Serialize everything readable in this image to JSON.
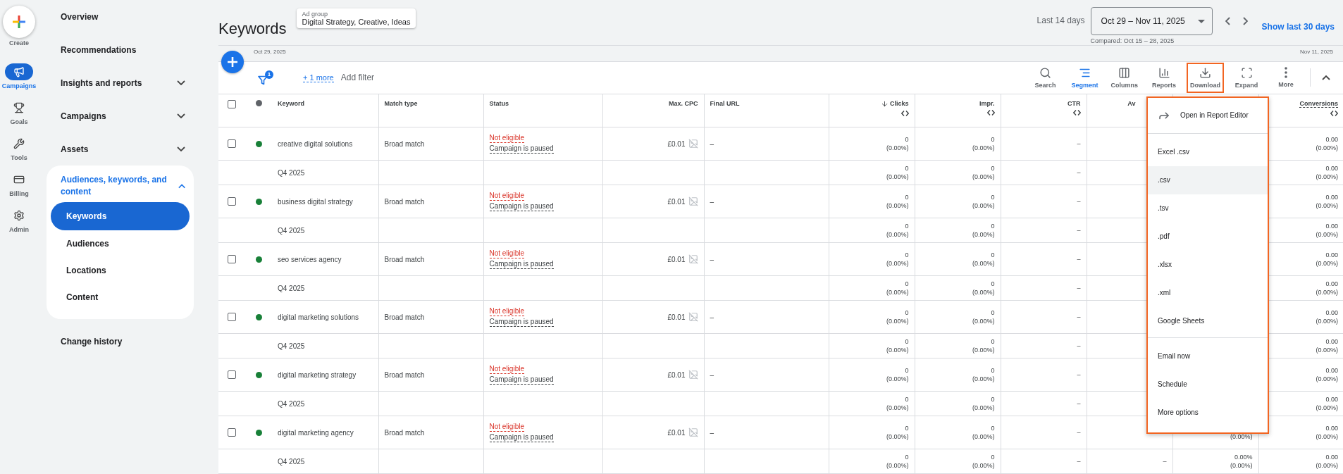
{
  "create": {
    "label": "Create"
  },
  "rail": [
    {
      "label": "Campaigns",
      "selected": true
    },
    {
      "label": "Goals",
      "selected": false
    },
    {
      "label": "Tools",
      "selected": false
    },
    {
      "label": "Billing",
      "selected": false
    },
    {
      "label": "Admin",
      "selected": false
    }
  ],
  "nav": [
    {
      "kind": "link",
      "label": "Overview"
    },
    {
      "kind": "link",
      "label": "Recommendations"
    },
    {
      "kind": "group",
      "label": "Insights and reports",
      "expanded": false
    },
    {
      "kind": "group",
      "label": "Campaigns",
      "expanded": false
    },
    {
      "kind": "group",
      "label": "Assets",
      "expanded": false
    },
    {
      "kind": "group",
      "label": "Audiences, keywords, and content",
      "expanded": true,
      "children": [
        {
          "label": "Keywords",
          "selected": true
        },
        {
          "label": "Audiences",
          "selected": false
        },
        {
          "label": "Locations",
          "selected": false
        },
        {
          "label": "Content",
          "selected": false
        }
      ]
    },
    {
      "kind": "link",
      "label": "Change history"
    }
  ],
  "header": {
    "title": "Keywords",
    "ad_group_label": "Ad group",
    "ad_group": "Digital Strategy, Creative, Ideas",
    "range_label": "Last 14 days",
    "date_range": "Oct 29 – Nov 11, 2025",
    "compared": "Compared: Oct 15 – 28, 2025",
    "show_link": "Show last 30 days"
  },
  "timeline": {
    "start": "Oct 29, 2025",
    "end": "Nov 11, 2025"
  },
  "filter": {
    "count": "1",
    "more": "+ 1 more",
    "add": "Add filter"
  },
  "toolbar": [
    {
      "label": "Search",
      "selected": false,
      "highlighted": false
    },
    {
      "label": "Segment",
      "selected": true,
      "highlighted": false
    },
    {
      "label": "Columns",
      "selected": false,
      "highlighted": false
    },
    {
      "label": "Reports",
      "selected": false,
      "highlighted": false
    },
    {
      "label": "Download",
      "selected": false,
      "highlighted": true
    },
    {
      "label": "Expand",
      "selected": false,
      "highlighted": false
    },
    {
      "label": "More",
      "selected": false,
      "highlighted": false
    }
  ],
  "table": {
    "header_checked": false,
    "columns": {
      "keyword": {
        "label": "Keyword"
      },
      "match_type": {
        "label": "Match type"
      },
      "status": {
        "label": "Status"
      },
      "max_cpc": {
        "label": "Max. CPC"
      },
      "final_url": {
        "label": "Final URL"
      },
      "clicks": {
        "label": "Clicks",
        "sorted": true,
        "toggle": true,
        "underlined": false
      },
      "impr": {
        "label": "Impr.",
        "sorted": false,
        "toggle": true,
        "underlined": false
      },
      "ctr": {
        "label": "CTR",
        "sorted": false,
        "toggle": true,
        "underlined": false
      },
      "av": {
        "label": "Av",
        "sorted": false,
        "toggle": false,
        "underlined": false
      },
      "conversions": {
        "label": "Conversions",
        "sorted": false,
        "toggle": true,
        "underlined": true
      }
    },
    "rows": [
      {
        "kind": "keyword",
        "checked": false,
        "active": true,
        "keyword": "creative digital solutions",
        "match_type": "Broad match",
        "status": "Not eligible",
        "status_reason": "Campaign is paused",
        "max_cpc": "£0.01",
        "final_url": "–",
        "metrics": {
          "clicks": {
            "value": "0",
            "pct": "(0.00%)"
          },
          "impr": {
            "value": "0",
            "pct": "(0.00%)"
          },
          "ctr": {
            "value": "–"
          },
          "conversions": {
            "value": "0.00",
            "pct": "(0.00%)"
          }
        }
      },
      {
        "kind": "segment",
        "label": "Q4 2025",
        "metrics": {
          "clicks": {
            "value": "0",
            "pct": "(0.00%)"
          },
          "impr": {
            "value": "0",
            "pct": "(0.00%)"
          },
          "ctr": {
            "value": "–"
          },
          "conversions": {
            "value": "0.00",
            "pct": "(0.00%)"
          }
        }
      },
      {
        "kind": "keyword",
        "checked": false,
        "active": true,
        "keyword": "business digital strategy",
        "match_type": "Broad match",
        "status": "Not eligible",
        "status_reason": "Campaign is paused",
        "max_cpc": "£0.01",
        "final_url": "–",
        "metrics": {
          "clicks": {
            "value": "0",
            "pct": "(0.00%)"
          },
          "impr": {
            "value": "0",
            "pct": "(0.00%)"
          },
          "ctr": {
            "value": "–"
          },
          "conversions": {
            "value": "0.00",
            "pct": "(0.00%)"
          }
        }
      },
      {
        "kind": "segment",
        "label": "Q4 2025",
        "metrics": {
          "clicks": {
            "value": "0",
            "pct": "(0.00%)"
          },
          "impr": {
            "value": "0",
            "pct": "(0.00%)"
          },
          "ctr": {
            "value": "–"
          },
          "conversions": {
            "value": "0.00",
            "pct": "(0.00%)"
          }
        }
      },
      {
        "kind": "keyword",
        "checked": false,
        "active": true,
        "keyword": "seo services agency",
        "match_type": "Broad match",
        "status": "Not eligible",
        "status_reason": "Campaign is paused",
        "max_cpc": "£0.01",
        "final_url": "–",
        "metrics": {
          "clicks": {
            "value": "0",
            "pct": "(0.00%)"
          },
          "impr": {
            "value": "0",
            "pct": "(0.00%)"
          },
          "ctr": {
            "value": "–"
          },
          "conversions": {
            "value": "0.00",
            "pct": "(0.00%)"
          }
        }
      },
      {
        "kind": "segment",
        "label": "Q4 2025",
        "metrics": {
          "clicks": {
            "value": "0",
            "pct": "(0.00%)"
          },
          "impr": {
            "value": "0",
            "pct": "(0.00%)"
          },
          "ctr": {
            "value": "–"
          },
          "conversions": {
            "value": "0.00",
            "pct": "(0.00%)"
          }
        }
      },
      {
        "kind": "keyword",
        "checked": false,
        "active": true,
        "keyword": "digital marketing solutions",
        "match_type": "Broad match",
        "status": "Not eligible",
        "status_reason": "Campaign is paused",
        "max_cpc": "£0.01",
        "final_url": "–",
        "metrics": {
          "clicks": {
            "value": "0",
            "pct": "(0.00%)"
          },
          "impr": {
            "value": "0",
            "pct": "(0.00%)"
          },
          "ctr": {
            "value": "–"
          },
          "conversions": {
            "value": "0.00",
            "pct": "(0.00%)"
          }
        }
      },
      {
        "kind": "segment",
        "label": "Q4 2025",
        "metrics": {
          "clicks": {
            "value": "0",
            "pct": "(0.00%)"
          },
          "impr": {
            "value": "0",
            "pct": "(0.00%)"
          },
          "ctr": {
            "value": "–"
          },
          "conversions": {
            "value": "0.00",
            "pct": "(0.00%)"
          }
        }
      },
      {
        "kind": "keyword",
        "checked": false,
        "active": true,
        "keyword": "digital marketing strategy",
        "match_type": "Broad match",
        "status": "Not eligible",
        "status_reason": "Campaign is paused",
        "max_cpc": "£0.01",
        "final_url": "–",
        "metrics": {
          "clicks": {
            "value": "0",
            "pct": "(0.00%)"
          },
          "impr": {
            "value": "0",
            "pct": "(0.00%)"
          },
          "ctr": {
            "value": "–"
          },
          "conversions": {
            "value": "0.00",
            "pct": "(0.00%)"
          }
        }
      },
      {
        "kind": "segment",
        "label": "Q4 2025",
        "metrics": {
          "clicks": {
            "value": "0",
            "pct": "(0.00%)"
          },
          "impr": {
            "value": "0",
            "pct": "(0.00%)"
          },
          "ctr": {
            "value": "–"
          },
          "conversions": {
            "value": "0.00",
            "pct": "(0.00%)"
          }
        }
      },
      {
        "kind": "keyword",
        "checked": false,
        "active": true,
        "keyword": "digital marketing agency",
        "match_type": "Broad match",
        "status": "Not eligible",
        "status_reason": "Campaign is paused",
        "max_cpc": "£0.01",
        "final_url": "–",
        "metrics": {
          "clicks": {
            "value": "0",
            "pct": "(0.00%)"
          },
          "impr": {
            "value": "0",
            "pct": "(0.00%)"
          },
          "ctr": {
            "value": "–"
          },
          "column_12": {
            "pct": "(0.00%)"
          },
          "conversions": {
            "value": "0.00",
            "pct": "(0.00%)"
          }
        }
      },
      {
        "kind": "segment",
        "label": "Q4 2025",
        "metrics": {
          "clicks": {
            "value": "0",
            "pct": "(0.00%)"
          },
          "impr": {
            "value": "0",
            "pct": "(0.00%)"
          },
          "ctr": {
            "value": "–"
          },
          "av": {
            "value": "–"
          },
          "column_12": {
            "value": "0.00%",
            "pct": "(0.00%)"
          },
          "conversions": {
            "value": "0.00",
            "pct": "(0.00%)"
          }
        }
      }
    ]
  },
  "download_menu": {
    "sections": [
      [
        {
          "label": "Open in Report Editor",
          "hovered": false
        }
      ],
      [
        {
          "label": "Excel .csv",
          "hovered": false
        },
        {
          "label": ".csv",
          "hovered": true
        },
        {
          "label": ".tsv",
          "hovered": false
        },
        {
          "label": ".pdf",
          "hovered": false
        },
        {
          "label": ".xlsx",
          "hovered": false
        },
        {
          "label": ".xml",
          "hovered": false
        },
        {
          "label": "Google Sheets",
          "hovered": false
        }
      ],
      [
        {
          "label": "Email now",
          "hovered": false
        },
        {
          "label": "Schedule",
          "hovered": false
        },
        {
          "label": "More options",
          "hovered": false
        }
      ]
    ]
  }
}
